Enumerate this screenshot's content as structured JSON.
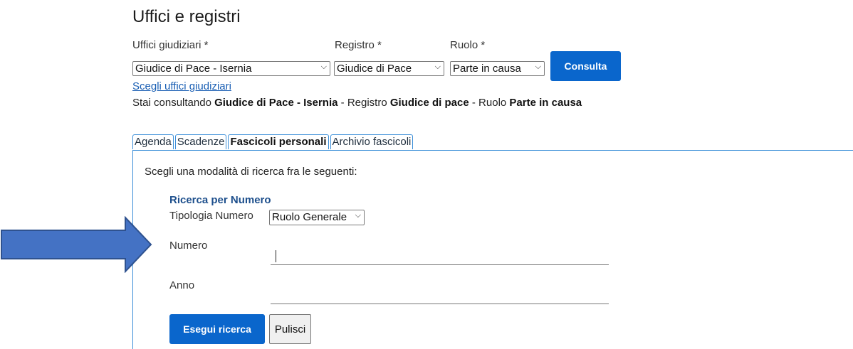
{
  "header": {
    "title": "Uffici e registri"
  },
  "filters": {
    "uffici_label": "Uffici giudiziari *",
    "registro_label": "Registro *",
    "ruolo_label": "Ruolo *",
    "uffici_value": "Giudice di Pace - Isernia",
    "registro_value": "Giudice di Pace",
    "ruolo_value": "Parte in causa",
    "consulta_label": "Consulta",
    "choose_link": "Scegli uffici giudiziari"
  },
  "status": {
    "prefix": "Stai consultando ",
    "office": "Giudice di Pace - Isernia",
    "registro_prefix": " - Registro ",
    "registro": "Giudice di pace",
    "ruolo_prefix": " - Ruolo ",
    "ruolo": "Parte in causa"
  },
  "tabs": [
    {
      "label": "Agenda"
    },
    {
      "label": "Scadenze"
    },
    {
      "label": "Fascicoli personali"
    },
    {
      "label": "Archivio fascicoli"
    }
  ],
  "search": {
    "prompt": "Scegli una modalità di ricerca fra le seguenti:",
    "section_title": "Ricerca per Numero",
    "tipologia_label": "Tipologia Numero",
    "tipologia_value": "Ruolo Generale",
    "numero_label": "Numero",
    "numero_value": "",
    "anno_label": "Anno",
    "anno_value": "",
    "submit_label": "Esegui ricerca",
    "reset_label": "Pulisci"
  },
  "colors": {
    "primary": "#0a66cc",
    "tab_border": "#3a8ed8",
    "link": "#1a5fb4",
    "arrow": "#4472c4"
  },
  "icons": {
    "select": "chevron-down-icon",
    "pointer": "arrow-right-icon"
  }
}
